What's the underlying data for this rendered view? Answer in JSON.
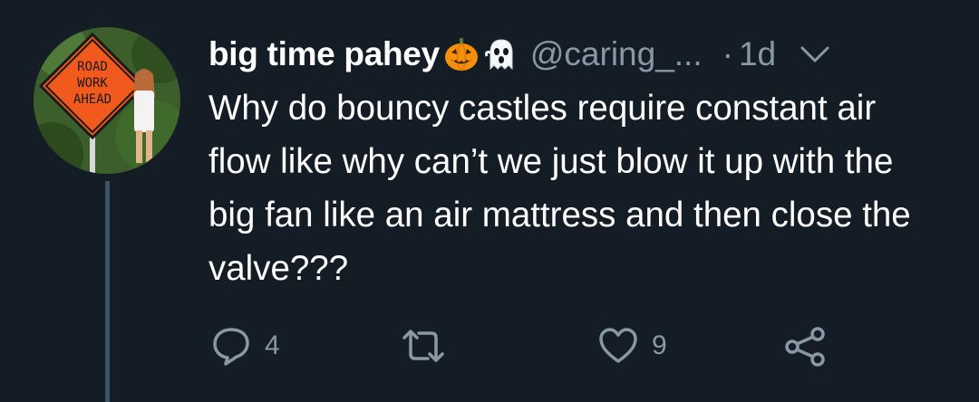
{
  "tweet": {
    "display_name": "big time pahey",
    "name_emojis": [
      "jack-o-lantern-icon",
      "ghost-icon"
    ],
    "handle": "@caring_...",
    "separator": "·",
    "time": "1d",
    "text": "Why do bouncy castles require constant air flow like why can’t we just blow it up with the big fan like an air mattress and then close the valve???",
    "avatar": {
      "sign_text": [
        "ROAD",
        "WORK",
        "AHEAD"
      ]
    }
  },
  "actions": {
    "reply": {
      "icon": "reply-icon",
      "count": "4"
    },
    "retweet": {
      "icon": "retweet-icon",
      "count": ""
    },
    "like": {
      "icon": "heart-icon",
      "count": "9"
    },
    "share": {
      "icon": "share-icon"
    }
  },
  "colors": {
    "background": "#141d26",
    "primary_text": "#ffffff",
    "secondary_text": "#8899a6",
    "thread_line": "#3d5466",
    "sign_orange": "#f25a1d"
  }
}
